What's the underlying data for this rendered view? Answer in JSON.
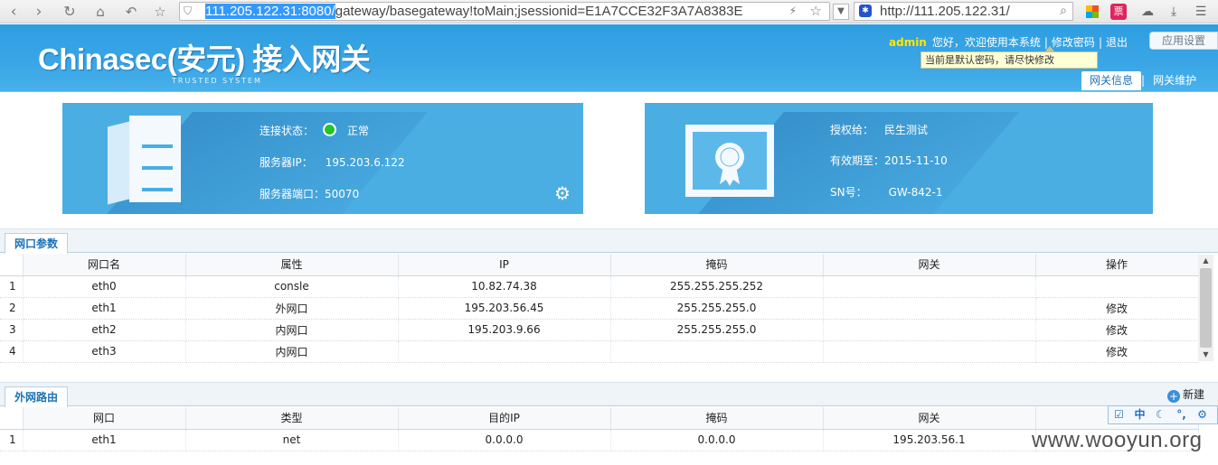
{
  "browser": {
    "address_selected": "111.205.122.31:8080/",
    "address_rest": "gateway/basegateway!toMain;jsessionid=E1A7CCE32F3A7A8383E",
    "search_text": "http://111.205.122.31/",
    "ticket_ext": "票"
  },
  "header": {
    "logo": "Chinasec(安元) 接入网关",
    "logo_sub": "TRUSTED SYSTEM",
    "user": "admin",
    "greeting": "您好，欢迎使用本系统",
    "change_password": "修改密码",
    "logout": "退出",
    "settings": "应用设置",
    "tooltip": "当前是默认密码，请尽快修改",
    "tabs": [
      "网关信息",
      "网关维护"
    ]
  },
  "server_card": {
    "status_label": "连接状态：",
    "status_value": "正常",
    "ip_label": "服务器IP：",
    "ip_value": "195.203.6.122",
    "port_label": "服务器端口：",
    "port_value": "50070"
  },
  "license_card": {
    "licensee_label": "授权给：",
    "licensee_value": "民生测试",
    "expiry_label": "有效期至：",
    "expiry_value": "2015-11-10",
    "sn_label": "SN号：",
    "sn_value": "GW-842-1"
  },
  "interfaces": {
    "title": "网口参数",
    "columns": [
      "",
      "网口名",
      "属性",
      "IP",
      "掩码",
      "网关",
      "操作"
    ],
    "rows": [
      [
        "1",
        "eth0",
        "consle",
        "10.82.74.38",
        "255.255.255.252",
        "",
        ""
      ],
      [
        "2",
        "eth1",
        "外网口",
        "195.203.56.45",
        "255.255.255.0",
        "",
        "修改"
      ],
      [
        "3",
        "eth2",
        "内网口",
        "195.203.9.66",
        "255.255.255.0",
        "",
        "修改"
      ],
      [
        "4",
        "eth3",
        "内网口",
        "",
        "",
        "",
        "修改"
      ]
    ]
  },
  "routes": {
    "title": "外网路由",
    "new_label": "新建",
    "columns": [
      "",
      "网口",
      "类型",
      "目的IP",
      "掩码",
      "网关",
      "操"
    ],
    "rows": [
      [
        "1",
        "eth1",
        "net",
        "0.0.0.0",
        "0.0.0.0",
        "195.203.56.1",
        ""
      ]
    ]
  },
  "ime": {
    "lang": "中"
  },
  "watermark": "www.wooyun.org",
  "colors": {
    "header_blue": "#3aa6e6",
    "card_blue": "#4aaee3",
    "status_green": "#22c52a",
    "admin_yellow": "#ffe600"
  }
}
